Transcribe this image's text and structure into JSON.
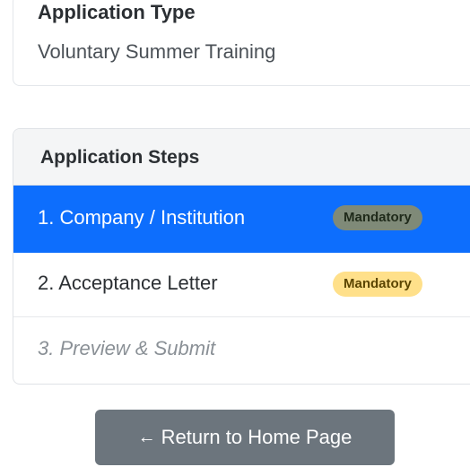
{
  "application_type": {
    "label": "Application Type",
    "value": "Voluntary Summer Training"
  },
  "steps": {
    "header": "Application Steps",
    "items": [
      {
        "label": "1. Company / Institution",
        "badge": "Mandatory",
        "state": "active"
      },
      {
        "label": "2. Acceptance Letter",
        "badge": "Mandatory",
        "state": "normal"
      },
      {
        "label": "3. Preview & Submit",
        "badge": "",
        "state": "disabled"
      }
    ]
  },
  "return_button": {
    "arrow": "←",
    "label": "Return to Home Page"
  },
  "colors": {
    "active_blue": "#0d6efd",
    "secondary_gray": "#6c757d",
    "warning_yellow": "#ffe08a"
  }
}
